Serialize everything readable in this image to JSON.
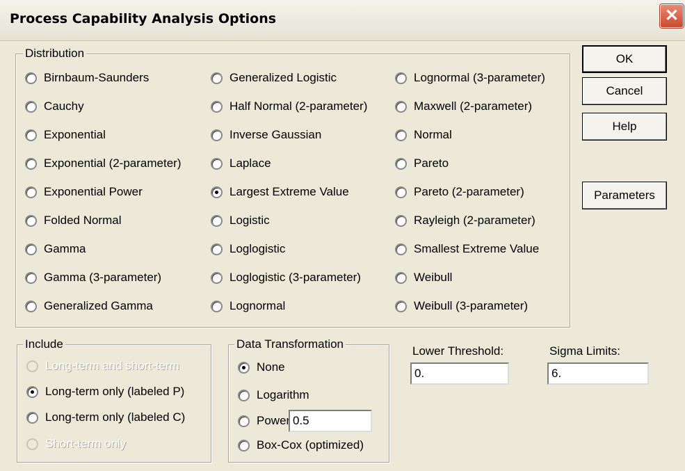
{
  "window": {
    "title": "Process Capability Analysis Options",
    "close_symbol": "✕"
  },
  "distribution": {
    "legend": "Distribution",
    "options": [
      [
        "Birnbaum-Saunders",
        "Cauchy",
        "Exponential",
        "Exponential (2-parameter)",
        "Exponential Power",
        "Folded Normal",
        "Gamma",
        "Gamma (3-parameter)",
        "Generalized Gamma"
      ],
      [
        "Generalized Logistic",
        "Half Normal (2-parameter)",
        "Inverse Gaussian",
        "Laplace",
        "Largest Extreme Value",
        "Logistic",
        "Loglogistic",
        "Loglogistic (3-parameter)",
        "Lognormal"
      ],
      [
        "Lognormal (3-parameter)",
        "Maxwell (2-parameter)",
        "Normal",
        "Pareto",
        "Pareto (2-parameter)",
        "Rayleigh (2-parameter)",
        "Smallest Extreme Value",
        "Weibull",
        "Weibull (3-parameter)"
      ]
    ],
    "selected": "Largest Extreme Value"
  },
  "buttons": {
    "ok": "OK",
    "cancel": "Cancel",
    "help": "Help",
    "parameters": "Parameters"
  },
  "include": {
    "legend": "Include",
    "options": [
      {
        "label": "Long-term and short-term",
        "enabled": false
      },
      {
        "label": "Long-term only (labeled P)",
        "enabled": true
      },
      {
        "label": "Long-term only (labeled C)",
        "enabled": true
      },
      {
        "label": "Short-term only",
        "enabled": false
      }
    ],
    "selected": "Long-term only (labeled P)"
  },
  "transformation": {
    "legend": "Data Transformation",
    "none": "None",
    "logarithm": "Logarithm",
    "power": "Power:",
    "power_value": "0.5",
    "boxcox": "Box-Cox (optimized)",
    "selected": "None"
  },
  "lower_threshold": {
    "label": "Lower Threshold:",
    "value": "0."
  },
  "sigma_limits": {
    "label": "Sigma Limits:",
    "value": "6."
  }
}
